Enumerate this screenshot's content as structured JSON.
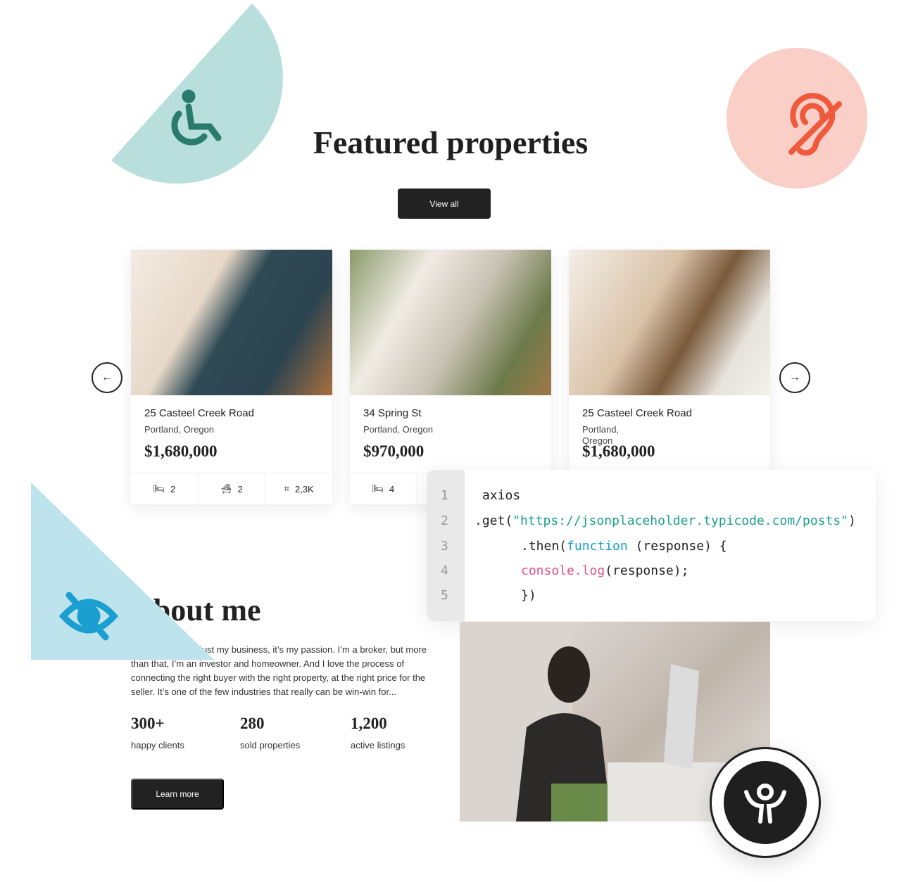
{
  "header": {
    "title": "Featured properties",
    "view_all": "View all"
  },
  "decor": {
    "icons": [
      "wheelchair-icon",
      "hearing-impaired-icon",
      "eye-slash-icon",
      "accessibility-person-icon"
    ],
    "colors": {
      "teal": "#b8dfdc",
      "salmon": "#f9cfc7",
      "lightblue": "#bde3ec",
      "teal_icon": "#2a7a6e",
      "red_icon": "#f05a3c",
      "blue_icon": "#1a9fd0"
    }
  },
  "carousel": {
    "prev": "arrow-left",
    "next": "arrow-right"
  },
  "properties": [
    {
      "name": "25 Casteel Creek Road",
      "location": "Portland, Oregon",
      "price": "$1,680,000",
      "beds": "2",
      "baths": "2",
      "area": "2,3K"
    },
    {
      "name": "34 Spring St",
      "location": "Portland, Oregon",
      "price": "$970,000",
      "beds": "4"
    },
    {
      "name": "25 Casteel Creek Road",
      "location": "Portland, Oregon",
      "price": "$1,680,000"
    }
  ],
  "code": {
    "line_numbers": [
      "1",
      "2",
      "3",
      "4",
      "5"
    ],
    "l1": "axios",
    "l2a": ".get(",
    "l2b": "\"https://jsonplaceholder.typicode.com/posts\"",
    "l2c": ")",
    "l3a": ".then(",
    "l3b": "function",
    "l3c": " (response) {",
    "l4a": "console.log",
    "l4b": "(response);",
    "l5": "})"
  },
  "about": {
    "title": "About me",
    "text": "just my business, it’s my passion. I’m a broker, but more than that, I’m an investor and homeowner. And I love the process of connecting the right buyer with the right property, at the right price for the seller. It’s one of the few industries that really can be win-win for...",
    "stats": [
      {
        "value": "300+",
        "label": "happy clients"
      },
      {
        "value": "280",
        "label": "sold properties"
      },
      {
        "value": "1,200",
        "label": "active listings"
      }
    ],
    "learn_more": "Learn more"
  }
}
